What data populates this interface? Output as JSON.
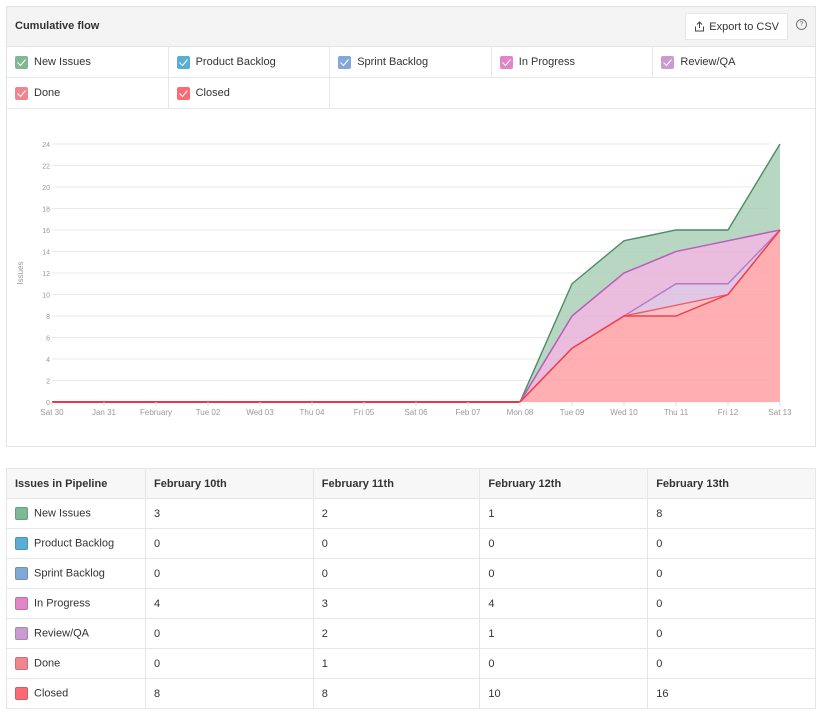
{
  "panel": {
    "title": "Cumulative flow",
    "export_label": "Export to CSV",
    "export_icon": "upload-share-icon",
    "help_icon": "question-circle-icon"
  },
  "legend": [
    {
      "label": "New Issues",
      "color": "#7fb894",
      "checked": true
    },
    {
      "label": "Product Backlog",
      "color": "#5aaed6",
      "checked": true
    },
    {
      "label": "Sprint Backlog",
      "color": "#82a8d8",
      "checked": true
    },
    {
      "label": "In Progress",
      "color": "#e284c8",
      "checked": true
    },
    {
      "label": "Review/QA",
      "color": "#c99bd0",
      "checked": true
    },
    {
      "label": "Done",
      "color": "#f08590",
      "checked": true
    },
    {
      "label": "Closed",
      "color": "#fb6b74",
      "checked": true
    }
  ],
  "chart_data": {
    "type": "area",
    "stacked": true,
    "title": "Cumulative flow",
    "xlabel": "",
    "ylabel": "Issues",
    "ylim": [
      0,
      24
    ],
    "yticks": [
      0,
      2,
      4,
      6,
      8,
      10,
      12,
      14,
      16,
      18,
      20,
      22,
      24
    ],
    "grid": true,
    "categories": [
      "Sat 30",
      "Jan 31",
      "February",
      "Tue 02",
      "Wed 03",
      "Thu 04",
      "Fri 05",
      "Sat 06",
      "Feb 07",
      "Mon 08",
      "Tue 09",
      "Wed 10",
      "Thu 11",
      "Fri 12",
      "Sat 13"
    ],
    "series": [
      {
        "name": "Closed",
        "color": "#f0404f",
        "fill": "#ffa0a5",
        "values": [
          0,
          0,
          0,
          0,
          0,
          0,
          0,
          0,
          0,
          0,
          5,
          8,
          8,
          10,
          16
        ]
      },
      {
        "name": "Done",
        "color": "#f05a66",
        "fill": "#f9b5bb",
        "values": [
          0,
          0,
          0,
          0,
          0,
          0,
          0,
          0,
          0,
          0,
          0,
          0,
          1,
          0,
          0
        ]
      },
      {
        "name": "Review/QA",
        "color": "#b57ac4",
        "fill": "#d9bde0",
        "values": [
          0,
          0,
          0,
          0,
          0,
          0,
          0,
          0,
          0,
          0,
          0,
          0,
          2,
          1,
          0
        ]
      },
      {
        "name": "In Progress",
        "color": "#c659b8",
        "fill": "#e6b0d8",
        "values": [
          0,
          0,
          0,
          0,
          0,
          0,
          0,
          0,
          0,
          0,
          3,
          4,
          3,
          4,
          0
        ]
      },
      {
        "name": "Sprint Backlog",
        "color": "#82a8d8",
        "fill": "#c3d5ec",
        "values": [
          0,
          0,
          0,
          0,
          0,
          0,
          0,
          0,
          0,
          0,
          0,
          0,
          0,
          0,
          0
        ]
      },
      {
        "name": "Product Backlog",
        "color": "#5aaed6",
        "fill": "#b5dcef",
        "values": [
          0,
          0,
          0,
          0,
          0,
          0,
          0,
          0,
          0,
          0,
          0,
          0,
          0,
          0,
          0
        ]
      },
      {
        "name": "New Issues",
        "color": "#4a8c64",
        "fill": "#acd0b9",
        "values": [
          0,
          0,
          0,
          0,
          0,
          0,
          0,
          0,
          0,
          0,
          3,
          3,
          2,
          1,
          8
        ]
      }
    ]
  },
  "table": {
    "headers": [
      "Issues in Pipeline",
      "February 10th",
      "February 11th",
      "February 12th",
      "February 13th"
    ],
    "rows": [
      {
        "label": "New Issues",
        "color": "#7fb894",
        "values": [
          "3",
          "2",
          "1",
          "8"
        ]
      },
      {
        "label": "Product Backlog",
        "color": "#5aaed6",
        "values": [
          "0",
          "0",
          "0",
          "0"
        ]
      },
      {
        "label": "Sprint Backlog",
        "color": "#82a8d8",
        "values": [
          "0",
          "0",
          "0",
          "0"
        ]
      },
      {
        "label": "In Progress",
        "color": "#e284c8",
        "values": [
          "4",
          "3",
          "4",
          "0"
        ]
      },
      {
        "label": "Review/QA",
        "color": "#c99bd0",
        "values": [
          "0",
          "2",
          "1",
          "0"
        ]
      },
      {
        "label": "Done",
        "color": "#f08590",
        "values": [
          "0",
          "1",
          "0",
          "0"
        ]
      },
      {
        "label": "Closed",
        "color": "#fb6b74",
        "values": [
          "8",
          "8",
          "10",
          "16"
        ]
      }
    ]
  }
}
